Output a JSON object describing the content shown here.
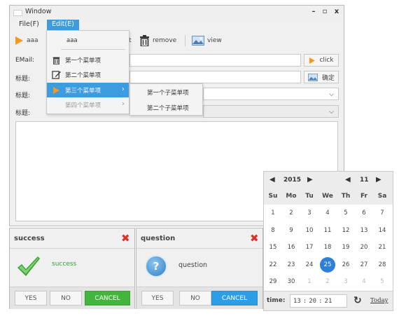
{
  "window": {
    "title": "Window",
    "minimize": "–",
    "maximize": "▫",
    "close": "x"
  },
  "menubar": {
    "file": "File(F)",
    "edit": "Edit(E)"
  },
  "toolbar": {
    "aaa": "aaa",
    "remove": "remove",
    "view": "view"
  },
  "form": {
    "email_label": "EMail:",
    "title_label": "标题:",
    "click_label": "click",
    "confirm_label": "确定"
  },
  "edit_menu": {
    "items": [
      {
        "label": "aaa"
      },
      {
        "label": "第一个菜单项"
      },
      {
        "label": "第二个菜单项"
      },
      {
        "label": "第三个菜单项"
      },
      {
        "label": "第四个菜单项"
      }
    ],
    "submenu": [
      {
        "label": "第一个子菜单项"
      },
      {
        "label": "第二个子菜单项"
      }
    ]
  },
  "dialog_success": {
    "title": "success",
    "message": "success",
    "yes": "YES",
    "no": "NO",
    "cancel": "CANCEL"
  },
  "dialog_question": {
    "title": "question",
    "message": "question",
    "icon": "?",
    "yes": "YES",
    "no": "NO",
    "cancel": "CANCEL"
  },
  "calendar": {
    "year": "2015",
    "month": "11",
    "weekdays": [
      "Su",
      "Mo",
      "Tu",
      "We",
      "Th",
      "Fr",
      "Sa"
    ],
    "weeks": [
      [
        "1",
        "2",
        "3",
        "4",
        "5",
        "6",
        "7"
      ],
      [
        "8",
        "9",
        "10",
        "11",
        "12",
        "13",
        "14"
      ],
      [
        "15",
        "16",
        "17",
        "18",
        "19",
        "20",
        "21"
      ],
      [
        "22",
        "23",
        "24",
        "25",
        "26",
        "27",
        "28"
      ],
      [
        "29",
        "30",
        "1",
        "2",
        "3",
        "4",
        "5"
      ]
    ],
    "selected_day": "25",
    "time_label": "time:",
    "hour": "13",
    "minute": "20",
    "second": "21",
    "time_sep": ":",
    "today": "Today"
  },
  "colors": {
    "accent": "#3d9be0",
    "success": "#43b53c",
    "danger": "#d9342b"
  }
}
